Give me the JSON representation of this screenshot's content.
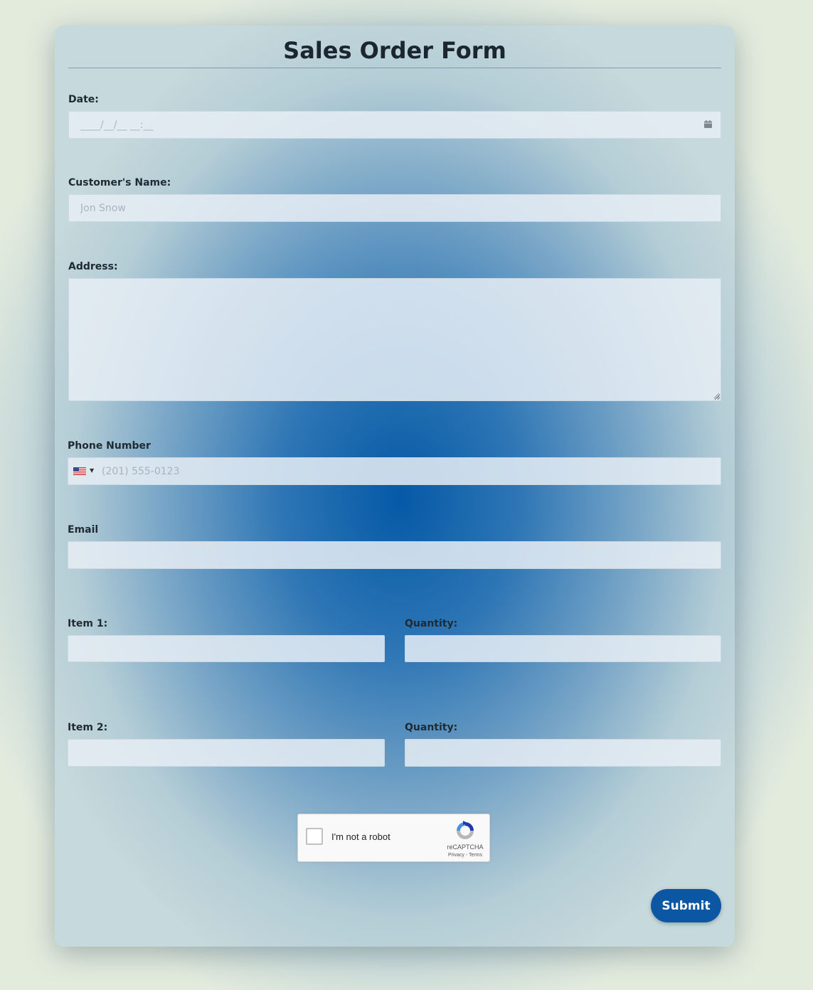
{
  "form": {
    "title": "Sales Order Form",
    "date": {
      "label": "Date:",
      "placeholder": "____/__/__ __:__",
      "icon": "calendar-icon"
    },
    "customer_name": {
      "label": "Customer's Name:",
      "placeholder": "Jon Snow"
    },
    "address": {
      "label": "Address:",
      "value": ""
    },
    "phone": {
      "label": "Phone Number",
      "placeholder": "(201) 555-0123",
      "country": "US",
      "icon": "us-flag-icon"
    },
    "email": {
      "label": "Email",
      "value": ""
    },
    "item1": {
      "label": "Item 1:",
      "quantity_label": "Quantity:"
    },
    "item2": {
      "label": "Item 2:",
      "quantity_label": "Quantity:"
    },
    "captcha": {
      "text": "I'm not a robot",
      "brand": "reCAPTCHA",
      "links": "Privacy - Terms"
    },
    "submit_label": "Submit"
  },
  "colors": {
    "accent": "#0b57a4",
    "title_text": "#1b2630",
    "field_background": "#e6eef4"
  }
}
